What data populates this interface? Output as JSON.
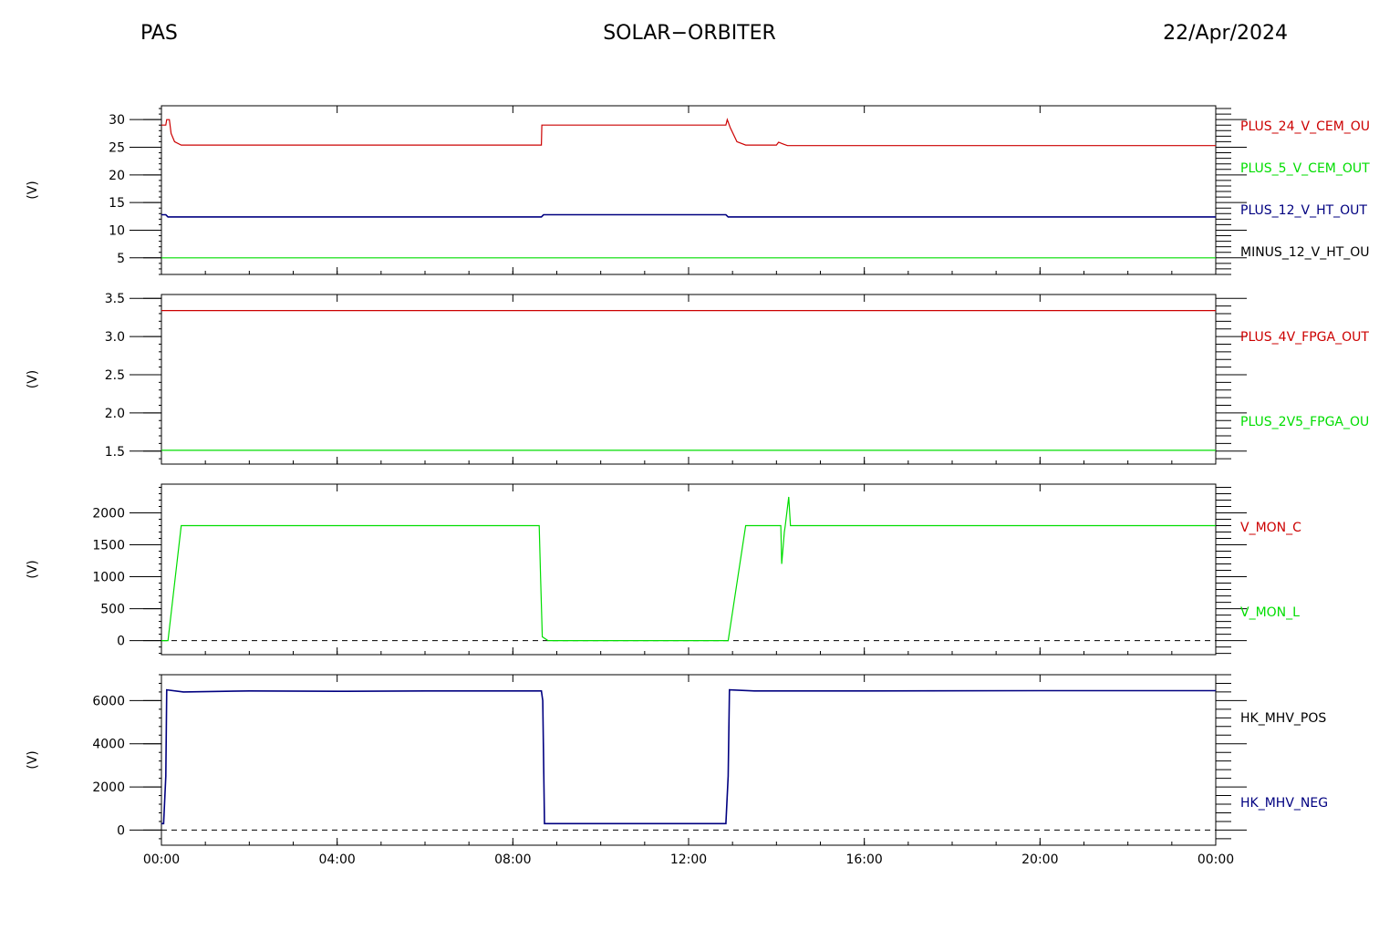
{
  "header": {
    "left": "PAS",
    "center": "SOLAR−ORBITER",
    "right": "22/Apr/2024"
  },
  "x_axis": {
    "ticks": [
      "00:00",
      "04:00",
      "08:00",
      "12:00",
      "16:00",
      "20:00",
      "00:00"
    ],
    "range_hours": [
      0,
      24
    ]
  },
  "chart_data": [
    {
      "type": "line",
      "ylabel": "(V)",
      "ylim": [
        2,
        32.5
      ],
      "yticks": [
        5,
        10,
        15,
        20,
        25,
        30
      ],
      "series": [
        {
          "name": "PLUS_24_V_CEM_OU",
          "color": "#cc0000",
          "points": [
            [
              0,
              29
            ],
            [
              0.1,
              29
            ],
            [
              0.12,
              30
            ],
            [
              0.18,
              30
            ],
            [
              0.22,
              27.5
            ],
            [
              0.3,
              26
            ],
            [
              0.45,
              25.4
            ],
            [
              8.65,
              25.4
            ],
            [
              8.66,
              29
            ],
            [
              12.85,
              29
            ],
            [
              12.88,
              30
            ],
            [
              12.95,
              28.5
            ],
            [
              13.1,
              26
            ],
            [
              13.3,
              25.4
            ],
            [
              14.0,
              25.4
            ],
            [
              14.05,
              25.9
            ],
            [
              14.15,
              25.6
            ],
            [
              14.25,
              25.3
            ],
            [
              24,
              25.3
            ]
          ]
        },
        {
          "name": "PLUS_5_V_CEM_OUT",
          "color": "#00dd00",
          "points": [
            [
              0,
              5
            ],
            [
              24,
              5
            ]
          ]
        },
        {
          "name": "PLUS_12_V_HT_OUT",
          "color": "#000080",
          "points": [
            [
              0,
              12.8
            ],
            [
              0.1,
              12.8
            ],
            [
              0.15,
              12.4
            ],
            [
              8.65,
              12.4
            ],
            [
              8.7,
              12.8
            ],
            [
              12.85,
              12.8
            ],
            [
              12.9,
              12.4
            ],
            [
              24,
              12.4
            ]
          ]
        },
        {
          "name": "MINUS_12_V_HT_OU",
          "color": "#000000",
          "points": []
        }
      ]
    },
    {
      "type": "line",
      "ylabel": "(V)",
      "ylim": [
        1.33,
        3.55
      ],
      "yticks": [
        1.5,
        2.0,
        2.5,
        3.0,
        3.5
      ],
      "series": [
        {
          "name": "PLUS_4V_FPGA_OUT",
          "color": "#cc0000",
          "points": [
            [
              0,
              3.34
            ],
            [
              24,
              3.34
            ]
          ]
        },
        {
          "name": "PLUS_2V5_FPGA_OU",
          "color": "#00dd00",
          "points": [
            [
              0,
              1.51
            ],
            [
              24,
              1.51
            ]
          ]
        }
      ]
    },
    {
      "type": "line",
      "ylabel": "(V)",
      "ylim": [
        -220,
        2450
      ],
      "yticks": [
        0,
        500,
        1000,
        1500,
        2000
      ],
      "baseline": 0,
      "series": [
        {
          "name": "V_MON_C",
          "color": "#cc0000",
          "points": []
        },
        {
          "name": "V_MON_L",
          "color": "#00dd00",
          "points": [
            [
              0,
              0
            ],
            [
              0.15,
              0
            ],
            [
              0.45,
              1800
            ],
            [
              8.6,
              1800
            ],
            [
              8.63,
              1000
            ],
            [
              8.67,
              60
            ],
            [
              8.8,
              0
            ],
            [
              12.9,
              0
            ],
            [
              13.3,
              1800
            ],
            [
              14.1,
              1800
            ],
            [
              14.12,
              1200
            ],
            [
              14.18,
              1700
            ],
            [
              14.2,
              1800
            ],
            [
              14.28,
              2250
            ],
            [
              14.32,
              1800
            ],
            [
              24,
              1800
            ]
          ]
        }
      ]
    },
    {
      "type": "line",
      "ylabel": "(V)",
      "ylim": [
        -700,
        7200
      ],
      "yticks": [
        0,
        2000,
        4000,
        6000
      ],
      "baseline": 0,
      "series": [
        {
          "name": "HK_MHV_POS",
          "color": "#000000",
          "points": []
        },
        {
          "name": "HK_MHV_NEG",
          "color": "#000080",
          "points": [
            [
              0,
              300
            ],
            [
              0.05,
              300
            ],
            [
              0.1,
              2500
            ],
            [
              0.12,
              6500
            ],
            [
              0.5,
              6400
            ],
            [
              2,
              6450
            ],
            [
              4,
              6430
            ],
            [
              6,
              6450
            ],
            [
              8.65,
              6450
            ],
            [
              8.68,
              6000
            ],
            [
              8.72,
              300
            ],
            [
              12.85,
              300
            ],
            [
              12.9,
              2500
            ],
            [
              12.93,
              6500
            ],
            [
              13.5,
              6450
            ],
            [
              16,
              6450
            ],
            [
              20,
              6460
            ],
            [
              24,
              6460
            ]
          ]
        }
      ]
    }
  ]
}
